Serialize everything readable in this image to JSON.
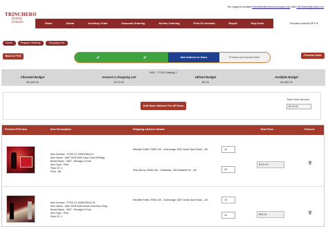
{
  "support": {
    "prefix": "For support contact",
    "email1": "helpdesk@ecihecknologies.net",
    "and": "and",
    "email2": "mill.flame@tpnbg.com"
  },
  "logo": {
    "line1": "TRINCHERO",
    "line2": "Family Estates"
  },
  "nav": [
    "Home",
    "Admin",
    "Inventory Order",
    "Seasonal Ordering",
    "Ad Hoc Ordering",
    "Print On Demand",
    "Report",
    "Help Desk"
  ],
  "admin": {
    "name": "Trinchero Admin RPT",
    "caret": "▾"
  },
  "breadcrumbs": [
    "Home",
    "Program Ordering",
    "Shopping Cart"
  ],
  "buttons": {
    "back": "Back to POS",
    "preview": "Preview Order",
    "same_address": "Add Same Address For All Items"
  },
  "steps": [
    {
      "label": "✔",
      "state": "done"
    },
    {
      "label": "✔",
      "state": "done"
    },
    {
      "label": "Add Address to Items",
      "state": "current"
    },
    {
      "label": "Preview and Submit Order",
      "state": "next"
    }
  ],
  "summary": {
    "title": "MAT - FY26 Catalog 2",
    "columns": [
      {
        "label": "Allocated Budget",
        "value": "$5,000.00"
      },
      {
        "label": "Amount in shopping cart",
        "value": "$170.00"
      },
      {
        "label": "Utilized Budget",
        "value": "$0.00"
      },
      {
        "label": "Available Budget",
        "value": "$4,830.00"
      }
    ]
  },
  "total_order": {
    "label": "Total Order Amount",
    "value": "$170.00"
  },
  "table": {
    "headers": [
      "Preview POS Item",
      "Item Description",
      "Shipping Address Details",
      "Total Price",
      "Remove"
    ],
    "rows": [
      {
        "desc": [
          "Item Number : PT26-C2-1098704514 6",
          "Item Name : MAT 2025 H&M Case Card Gift Bag",
          "Brand Name : MAT - Menage à Trois",
          "Item Type : Print",
          "Pack Of : 1",
          "Price : $6"
        ],
        "ship": [
          {
            "address": "Michelle Smith, RNDC AK - Anchorage, 6307 Arctic Spur Road, , AK",
            "qty": "10"
          },
          {
            "address": "Jerry Burns, RNDC AK - Fairbanks, 745 Elizabeth St, , AK",
            "qty": "10"
          }
        ],
        "price": "$120.00",
        "trash": "🗑"
      },
      {
        "desc": [
          "Item Number : PT26-C2-1098704514 28",
          "Item Name : MAT 2025 H&M Sweet Gold Box Cling",
          "Brand Name : MAT - Menage à Trois",
          "Item Type : Print",
          "Pack Of : 1"
        ],
        "ship": [
          {
            "address": "Michelle Smith, RNDC AK - Anchorage, 6307 Arctic Spur Road, , AK",
            "qty": "10"
          },
          {
            "address": "",
            "qty": "10"
          }
        ],
        "price": "$50.00",
        "trash": "🗑"
      }
    ]
  },
  "colors": {
    "brand": "#8c2a2a",
    "button": "#a33a2c",
    "step_done": "#3fa33f",
    "step_current": "#1f3f8f",
    "stepper_border": "#c97a2e"
  }
}
